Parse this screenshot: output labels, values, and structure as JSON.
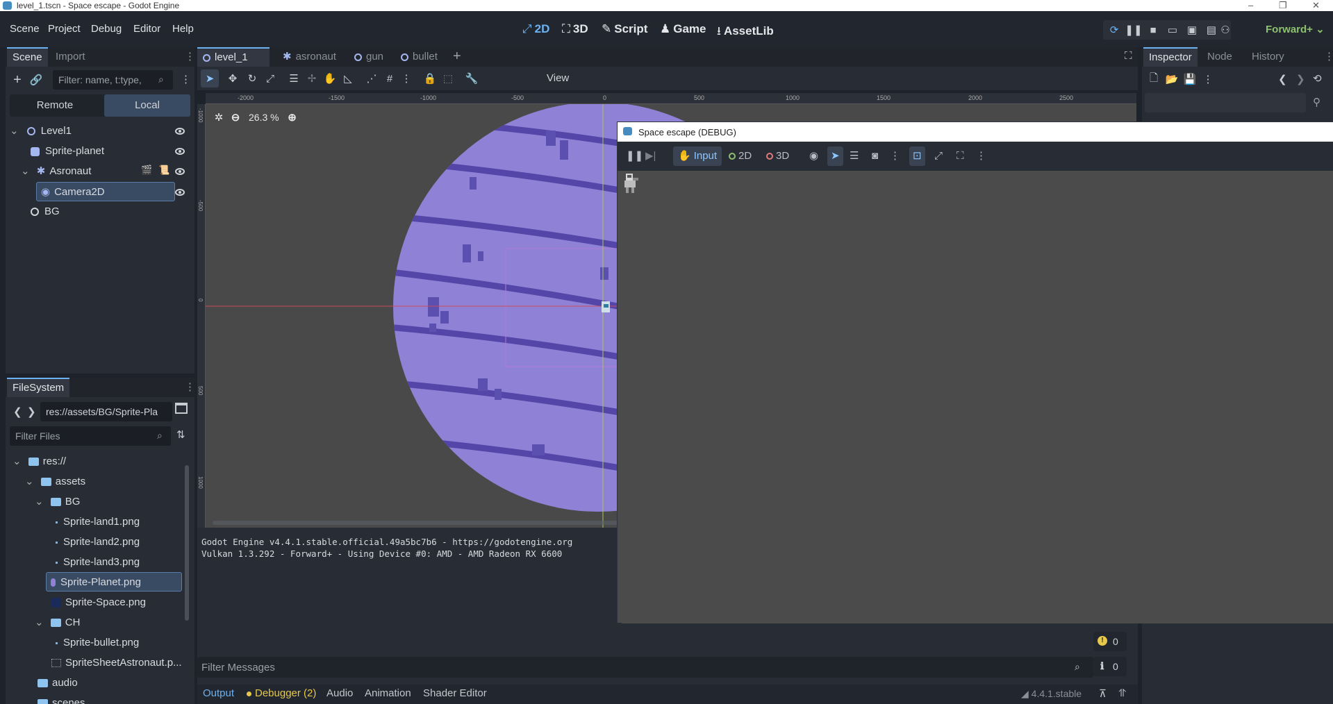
{
  "window": {
    "title": "level_1.tscn - Space escape - Godot Engine",
    "controls": [
      "–",
      "❐",
      "✕"
    ]
  },
  "menu": [
    "Scene",
    "Project",
    "Debug",
    "Editor",
    "Help"
  ],
  "workspaces": [
    {
      "glyph": "⤢",
      "label": "2D"
    },
    {
      "glyph": "⛶",
      "label": "3D"
    },
    {
      "glyph": "✎",
      "label": "Script"
    },
    {
      "glyph": "♟",
      "label": "Game"
    },
    {
      "glyph": "⭳",
      "label": "AssetLib"
    }
  ],
  "renderer": "Forward+",
  "scene_dock": {
    "tabs": [
      "Scene",
      "Import"
    ],
    "filter_placeholder": "Filter: name, t:type,",
    "remote_label": "Remote",
    "local_label": "Local",
    "nodes": [
      "Level1",
      "Sprite-planet",
      "Asronaut",
      "Camera2D",
      "BG"
    ]
  },
  "filesystem": {
    "tab": "FileSystem",
    "path": "res://assets/BG/Sprite-Pla",
    "filter_placeholder": "Filter Files",
    "items": [
      "res://",
      "assets",
      "BG",
      "Sprite-land1.png",
      "Sprite-land2.png",
      "Sprite-land3.png",
      "Sprite-Planet.png",
      "Sprite-Space.png",
      "CH",
      "Sprite-bullet.png",
      "SpriteSheetAstronaut.p...",
      "audio",
      "scenes"
    ]
  },
  "scene_tabs": [
    "level_1",
    "asronaut",
    "gun",
    "bullet"
  ],
  "toolbar": {
    "view_label": "View"
  },
  "ruler_x": [
    "-2000",
    "-1500",
    "-1000",
    "-500",
    "0",
    "500",
    "1000",
    "1500",
    "2000",
    "2500"
  ],
  "ruler_y": [
    "-1000",
    "-500",
    "0",
    "500",
    "1000"
  ],
  "zoom": "26.3 %",
  "debug_window": {
    "title": "Space escape (DEBUG)",
    "input_label": "Input",
    "mode_2d": "2D",
    "mode_3d": "3D"
  },
  "output": {
    "lines": [
      "Godot Engine v4.4.1.stable.official.49a5bc7b6 - https://godotengine.org",
      "Vulkan 1.3.292 - Forward+ - Using Device #0: AMD - AMD Radeon RX 6600"
    ],
    "filter_placeholder": "Filter Messages",
    "warnings": "0",
    "infos": "0"
  },
  "bottom_tabs": [
    "Output",
    "Debugger (2)",
    "Audio",
    "Animation",
    "Shader Editor"
  ],
  "version": "4.4.1.stable",
  "inspector": {
    "tabs": [
      "Inspector",
      "Node",
      "History"
    ]
  },
  "colors": {
    "accent": "#6cb2f2",
    "planet": "#8f81d6",
    "stripe": "#5346a8",
    "renderer": "#8cc26e",
    "debugger_dot": "#e6c84a"
  }
}
